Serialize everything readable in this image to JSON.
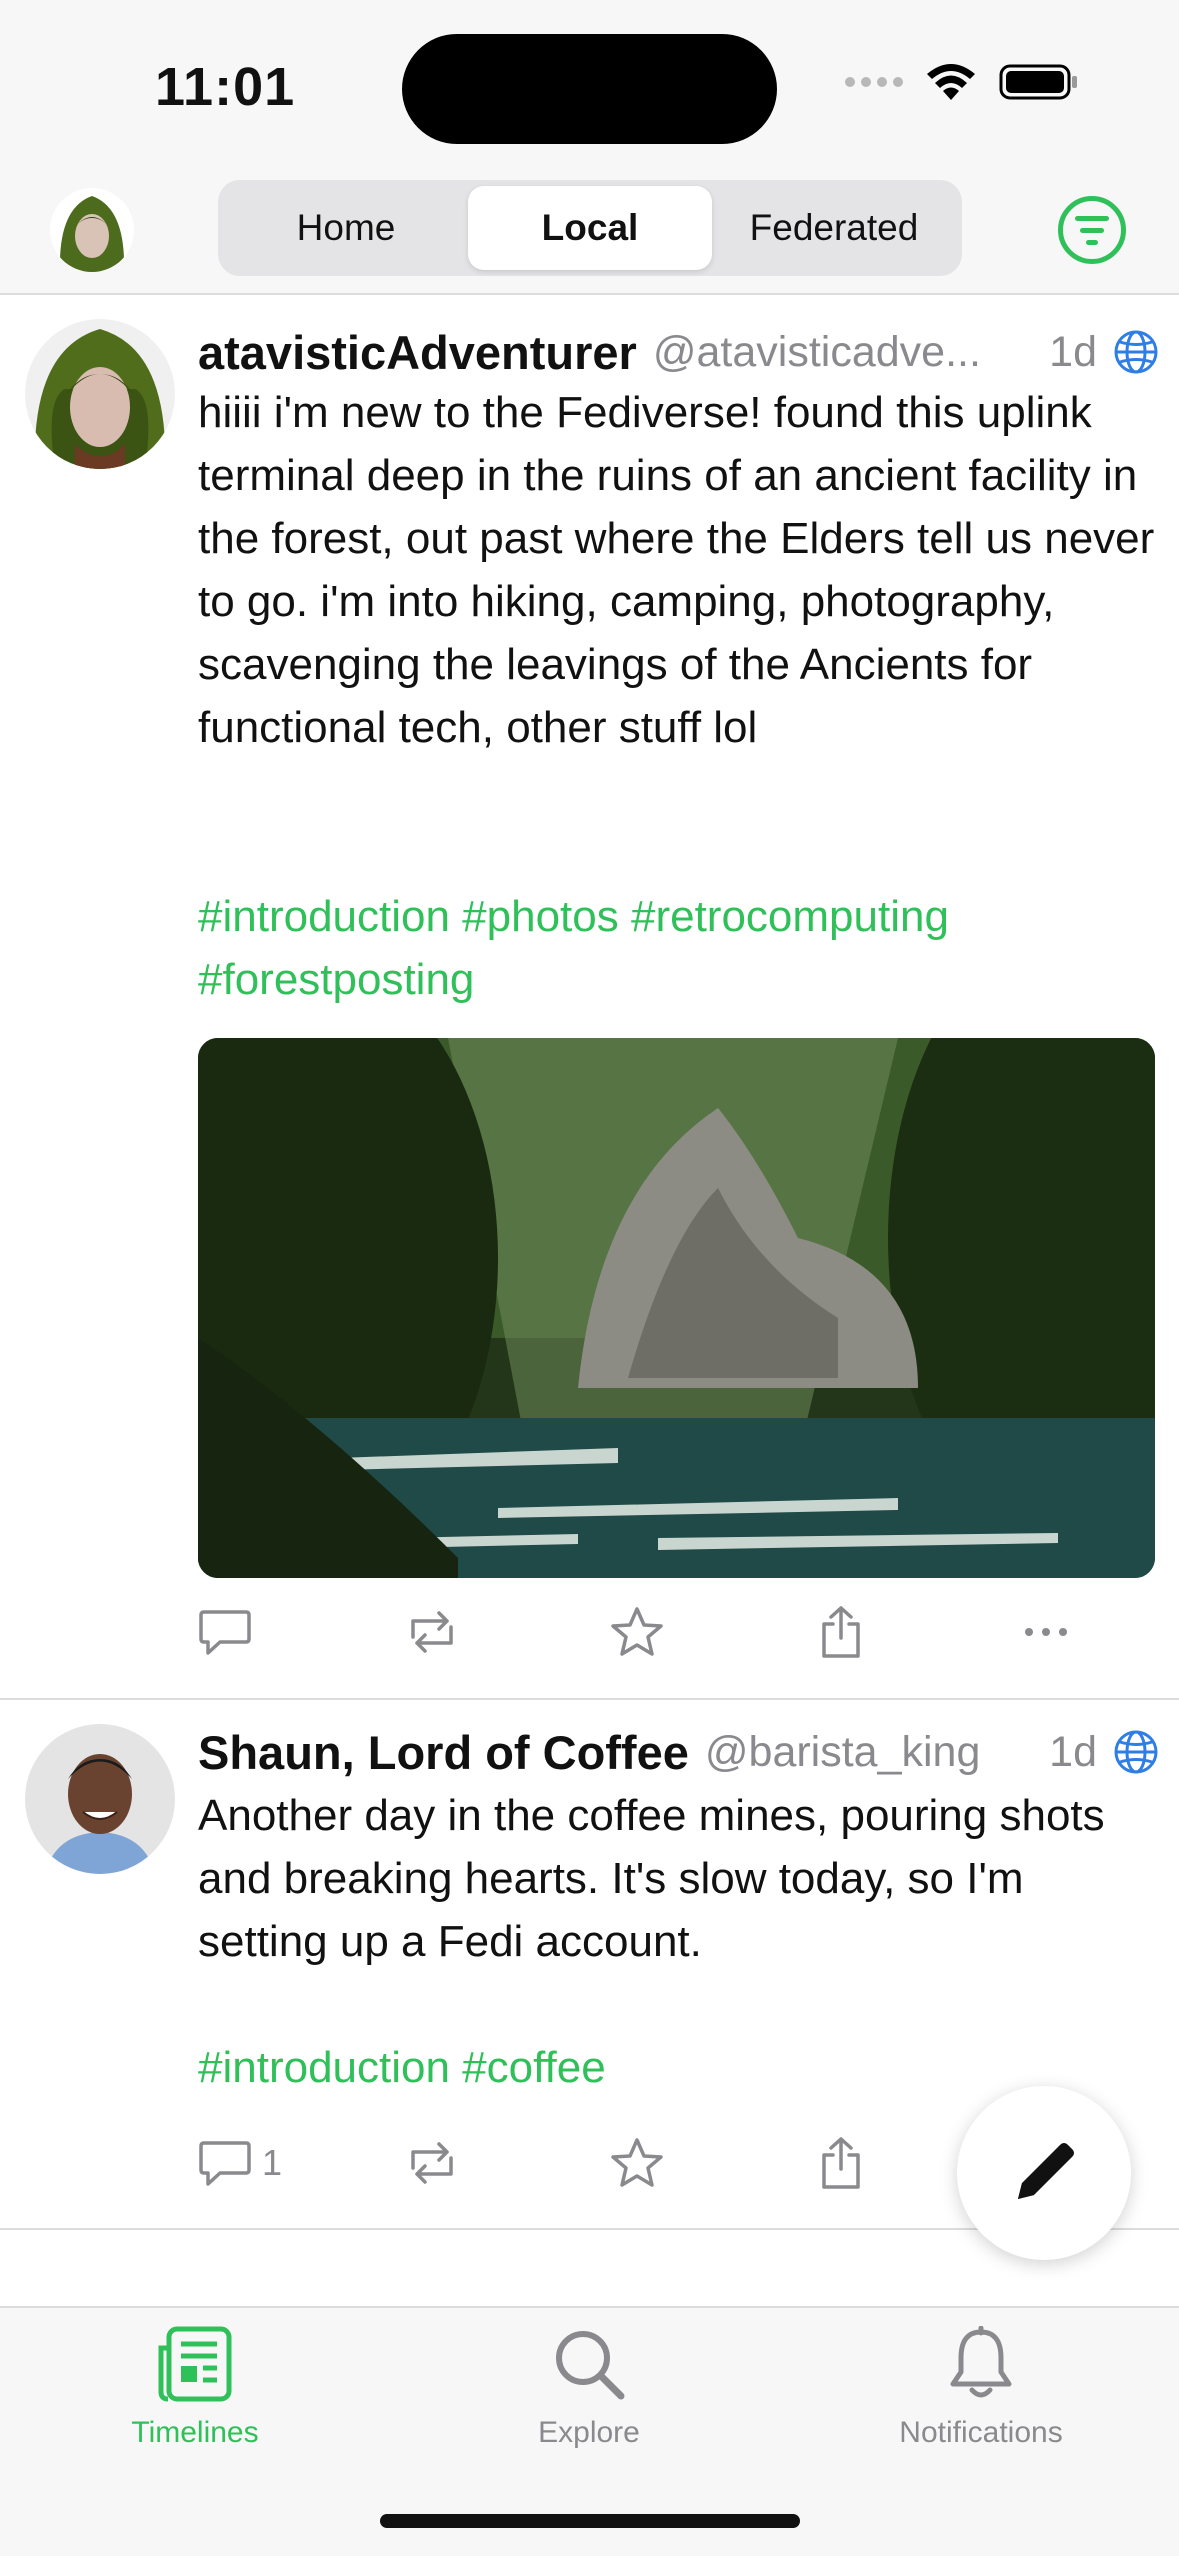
{
  "status_bar": {
    "time": "11:01"
  },
  "nav": {
    "tabs": [
      {
        "label": "Home",
        "active": false
      },
      {
        "label": "Local",
        "active": true
      },
      {
        "label": "Federated",
        "active": false
      }
    ],
    "filter_icon": "filter-icon"
  },
  "posts": [
    {
      "display_name": "atavisticAdventurer",
      "handle": "@atavisticadve...",
      "time": "1d",
      "visibility_icon": "globe-icon",
      "body": "hiiii i'm new to the Fediverse! found this uplink terminal deep in the ruins of an ancient facility in the forest, out past where the Elders tell us never to go. i'm into hiking, camping, photography, scavenging the leavings of the Ancients for functional tech, other stuff lol",
      "hashtags": "#introduction #photos #retrocomputing #forestposting",
      "reply_count": "",
      "has_image": true
    },
    {
      "display_name": "Shaun, Lord of Coffee",
      "handle": "@barista_king",
      "time": "1d",
      "visibility_icon": "globe-icon",
      "body": "Another day in the coffee mines, pouring shots and breaking hearts. It's slow today, so I'm setting up a Fedi account.",
      "hashtags": "#introduction #coffee",
      "reply_count": "1",
      "has_image": false
    }
  ],
  "tab_bar": {
    "items": [
      {
        "label": "Timelines",
        "icon": "timelines-icon",
        "active": true
      },
      {
        "label": "Explore",
        "icon": "search-icon",
        "active": false
      },
      {
        "label": "Notifications",
        "icon": "bell-icon",
        "active": false
      }
    ]
  },
  "colors": {
    "accent": "#30c05a",
    "secondary_text": "#8a8a8e",
    "globe": "#2f7ee6"
  }
}
